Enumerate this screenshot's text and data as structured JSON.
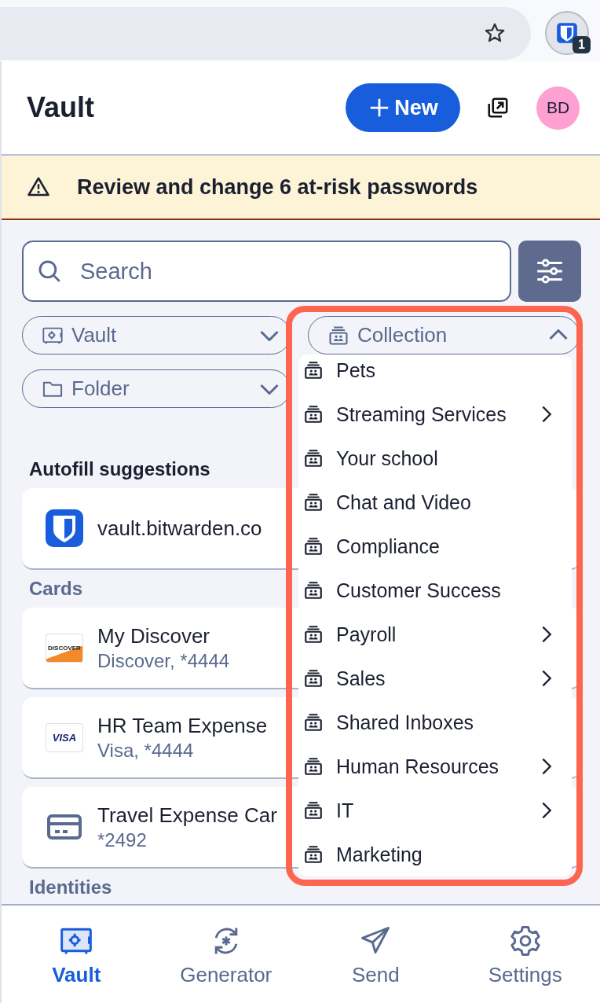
{
  "browser": {
    "extension_badge": "1"
  },
  "header": {
    "title": "Vault",
    "new_button": "New",
    "avatar": "BD"
  },
  "banner": {
    "text": "Review and change 6 at-risk passwords"
  },
  "search": {
    "placeholder": "Search"
  },
  "filters": [
    {
      "label": "Vault",
      "kind": "vault",
      "expanded": false
    },
    {
      "label": "Collection",
      "kind": "collection",
      "expanded": true
    },
    {
      "label": "Folder",
      "kind": "folder",
      "expanded": false
    }
  ],
  "collection_menu": [
    {
      "label": "Pets",
      "has_children": false
    },
    {
      "label": "Streaming Services",
      "has_children": true
    },
    {
      "label": "Your school",
      "has_children": false
    },
    {
      "label": "Chat and Video",
      "has_children": false
    },
    {
      "label": "Compliance",
      "has_children": false
    },
    {
      "label": "Customer Success",
      "has_children": false
    },
    {
      "label": "Payroll",
      "has_children": true
    },
    {
      "label": "Sales",
      "has_children": true
    },
    {
      "label": "Shared Inboxes",
      "has_children": false
    },
    {
      "label": "Human Resources",
      "has_children": true
    },
    {
      "label": "IT",
      "has_children": true
    },
    {
      "label": "Marketing",
      "has_children": false
    }
  ],
  "sections": [
    {
      "title": "Autofill suggestions",
      "kind": "autofill",
      "items": [
        {
          "kind": "login",
          "title": "vault.bitwarden.co"
        }
      ]
    },
    {
      "title": "Cards",
      "kind": "group",
      "items": [
        {
          "kind": "discover",
          "logo_text": "DISCOVER",
          "title": "My Discover",
          "subtitle": "Discover, *4444"
        },
        {
          "kind": "visa",
          "logo_text": "VISA",
          "title": "HR Team Expense",
          "subtitle": "Visa, *4444"
        },
        {
          "kind": "card",
          "title": "Travel Expense Car",
          "subtitle": "*2492"
        }
      ]
    },
    {
      "title": "Identities",
      "kind": "group"
    }
  ],
  "nav": [
    {
      "label": "Vault",
      "kind": "vault",
      "selected": true
    },
    {
      "label": "Generator",
      "kind": "generator",
      "selected": false
    },
    {
      "label": "Send",
      "kind": "send",
      "selected": false
    },
    {
      "label": "Settings",
      "kind": "settings",
      "selected": false
    }
  ]
}
